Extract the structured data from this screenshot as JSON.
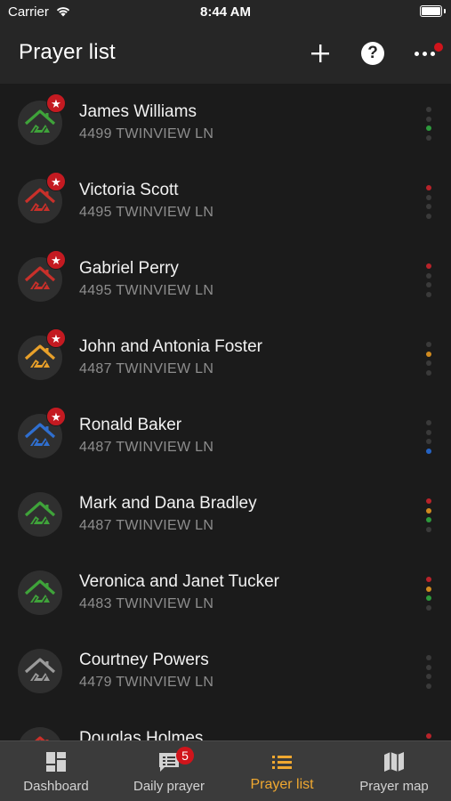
{
  "status_bar": {
    "carrier": "Carrier",
    "time": "8:44 AM"
  },
  "header": {
    "title": "Prayer list",
    "menu_has_notification": true
  },
  "prayer_list": [
    {
      "name": "James Williams",
      "address": "4499 TWINVIEW LN",
      "icon_color": "#3fa33a",
      "starred": true,
      "status_dots": [
        "#3a3a3a",
        "#3a3a3a",
        "#2d9a3c",
        "#3a3a3a"
      ]
    },
    {
      "name": "Victoria Scott",
      "address": "4495 TWINVIEW LN",
      "icon_color": "#c8302a",
      "starred": true,
      "status_dots": [
        "#b8232a",
        "#3a3a3a",
        "#3a3a3a",
        "#3a3a3a"
      ]
    },
    {
      "name": "Gabriel Perry",
      "address": "4495 TWINVIEW LN",
      "icon_color": "#c8302a",
      "starred": true,
      "status_dots": [
        "#b8232a",
        "#3a3a3a",
        "#3a3a3a",
        "#3a3a3a"
      ]
    },
    {
      "name": "John and Antonia Foster",
      "address": "4487 TWINVIEW LN",
      "icon_color": "#e8a02a",
      "starred": true,
      "status_dots": [
        "#3a3a3a",
        "#d08a1f",
        "#3a3a3a",
        "#3a3a3a"
      ]
    },
    {
      "name": "Ronald Baker",
      "address": "4487 TWINVIEW LN",
      "icon_color": "#2f6fd0",
      "starred": true,
      "status_dots": [
        "#3a3a3a",
        "#3a3a3a",
        "#3a3a3a",
        "#2563c4"
      ]
    },
    {
      "name": "Mark and Dana Bradley",
      "address": "4487 TWINVIEW LN",
      "icon_color": "#3fa33a",
      "starred": false,
      "status_dots": [
        "#b8232a",
        "#d08a1f",
        "#2d9a3c",
        "#3a3a3a"
      ]
    },
    {
      "name": "Veronica and Janet Tucker",
      "address": "4483 TWINVIEW LN",
      "icon_color": "#3fa33a",
      "starred": false,
      "status_dots": [
        "#b8232a",
        "#d08a1f",
        "#2d9a3c",
        "#3a3a3a"
      ]
    },
    {
      "name": "Courtney Powers",
      "address": "4479 TWINVIEW LN",
      "icon_color": "#9a9a9a",
      "starred": false,
      "status_dots": [
        "#3a3a3a",
        "#3a3a3a",
        "#3a3a3a",
        "#3a3a3a"
      ]
    },
    {
      "name": "Douglas Holmes",
      "address": "",
      "icon_color": "#c8302a",
      "starred": false,
      "status_dots": [
        "#b8232a",
        "#3a3a3a",
        "#3a3a3a",
        "#3a3a3a"
      ]
    }
  ],
  "tab_bar": {
    "tabs": [
      {
        "label": "Dashboard",
        "icon": "dashboard-icon",
        "active": false
      },
      {
        "label": "Daily prayer",
        "icon": "chat-list-icon",
        "active": false,
        "badge": "5"
      },
      {
        "label": "Prayer list",
        "icon": "list-icon",
        "active": true
      },
      {
        "label": "Prayer map",
        "icon": "map-icon",
        "active": false
      }
    ]
  },
  "colors": {
    "accent": "#f0a830",
    "badge": "#d0141b",
    "background": "#1b1b1b",
    "bar": "#262626"
  }
}
